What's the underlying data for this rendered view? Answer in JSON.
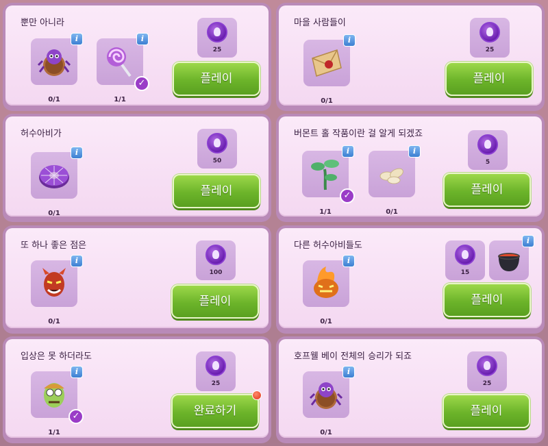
{
  "cards": [
    {
      "title": "뿐만 아니라",
      "items": [
        {
          "icon": "spider-cookie-icon",
          "count": "0/1",
          "done": false
        },
        {
          "icon": "lollipop-icon",
          "count": "1/1",
          "done": true
        }
      ],
      "reward": "25",
      "button": "플레이"
    },
    {
      "title": "마을 사람들이",
      "items": [
        {
          "icon": "letter-icon",
          "count": "0/1",
          "done": false
        }
      ],
      "reward": "25",
      "button": "플레이"
    },
    {
      "title": "허수아비가",
      "items": [
        {
          "icon": "donut-icon",
          "count": "0/1",
          "done": false
        }
      ],
      "reward": "50",
      "button": "플레이"
    },
    {
      "title": "버몬트 홀 작품이란 걸 알게 되겠죠",
      "items": [
        {
          "icon": "plant-icon",
          "count": "1/1",
          "done": true
        },
        {
          "icon": "seeds-icon",
          "count": "0/1",
          "done": false
        }
      ],
      "reward": "5",
      "button": "플레이"
    },
    {
      "title": "또 하나 좋은 점은",
      "items": [
        {
          "icon": "devil-mask-icon",
          "count": "0/1",
          "done": false
        }
      ],
      "reward": "100",
      "button": "플레이"
    },
    {
      "title": "다른 허수아비들도",
      "items": [
        {
          "icon": "fire-pumpkin-icon",
          "count": "0/1",
          "done": false
        }
      ],
      "reward": "15",
      "button": "플레이"
    },
    {
      "title": "입상은 못 하더라도",
      "items": [
        {
          "icon": "zombie-mask-icon",
          "count": "1/1",
          "done": true
        }
      ],
      "reward": "25",
      "button": "완료하기"
    },
    {
      "title": "호프웰 베이 전체의 승리가 되죠",
      "items": [
        {
          "icon": "spider-cookie-icon",
          "count": "0/1",
          "done": false
        }
      ],
      "reward": "25",
      "button": "플레이"
    }
  ],
  "labels": {
    "info": "i",
    "check": "✓"
  },
  "colors": {
    "button_green": "#6cb42a",
    "card_bg": "#f4d8f1",
    "coin_purple": "#6a1fb0"
  }
}
